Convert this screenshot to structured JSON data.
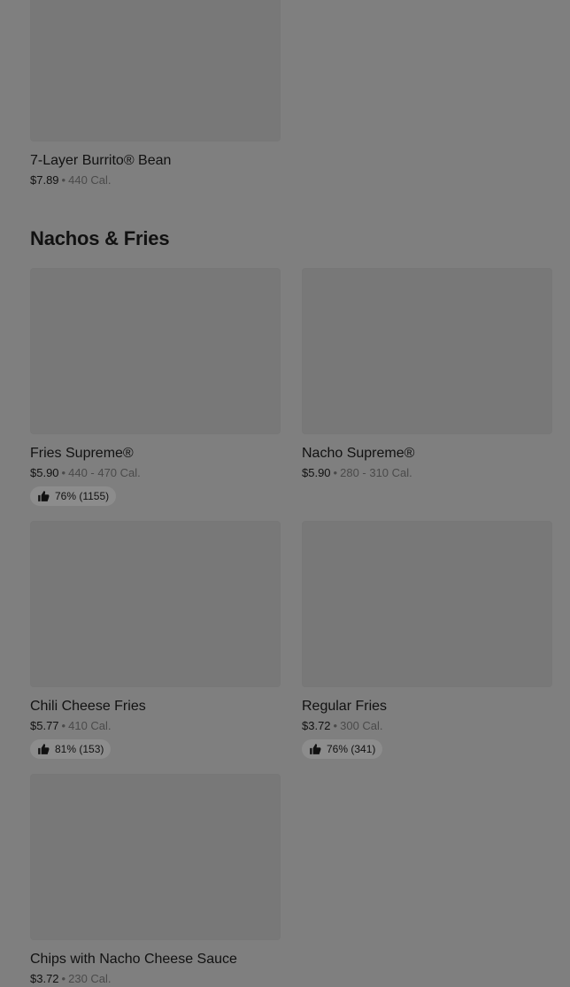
{
  "previous_section": {
    "items": [
      {
        "name": "7-Layer Burrito® Bean",
        "price": "$7.89",
        "separator": "•",
        "calories": "440 Cal."
      }
    ]
  },
  "nachos_fries": {
    "title": "Nachos & Fries",
    "items": [
      {
        "name": "Fries Supreme®",
        "price": "$5.90",
        "separator": "•",
        "calories": "440 - 470 Cal.",
        "rating": "76% (1155)"
      },
      {
        "name": "Nacho Supreme®",
        "price": "$5.90",
        "separator": "•",
        "calories": "280 - 310 Cal."
      },
      {
        "name": "Chili Cheese Fries",
        "price": "$5.77",
        "separator": "•",
        "calories": "410 Cal.",
        "rating": "81% (153)"
      },
      {
        "name": "Regular Fries",
        "price": "$3.72",
        "separator": "•",
        "calories": "300 Cal.",
        "rating": "76% (341)"
      },
      {
        "name": "Chips with Nacho Cheese Sauce",
        "price": "$3.72",
        "separator": "•",
        "calories": "230 Cal."
      }
    ]
  },
  "icons": {
    "rating": "thumbs-up-icon"
  },
  "colors": {
    "background": "#7f7f7f",
    "badge_accent": "#1d6a2c",
    "text": "#111111",
    "muted_text": "#4a4a4a"
  }
}
